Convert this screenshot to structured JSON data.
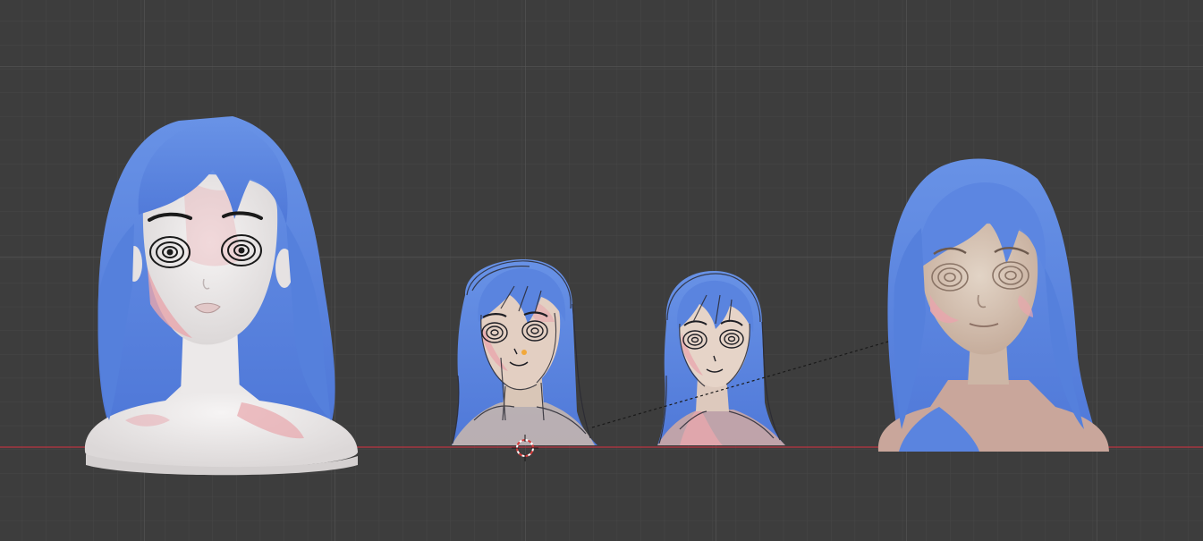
{
  "viewport": {
    "background": "#3d3d3d",
    "grid_minor_color": "#474747",
    "grid_major_color": "#515151",
    "x_axis_color": "#b8323f"
  },
  "objects": [
    {
      "name": "head-bust-1",
      "style": "smooth white skin, blue hair, spiral eyes"
    },
    {
      "name": "grease-pencil-sketch-1",
      "style": "sketch lines over painted bust"
    },
    {
      "name": "grease-pencil-sketch-2",
      "style": "sketch lines over painted bust"
    },
    {
      "name": "head-bust-2",
      "style": "textured skin, blue hair, spiral eyes"
    }
  ],
  "colors": {
    "hair": "#5b86e0",
    "hair_dark": "#3e63c4",
    "skin": "#f0eeee",
    "blush": "#e8a6ad",
    "skin_warm": "#d8c4b4",
    "ink": "#1a1a1a"
  }
}
